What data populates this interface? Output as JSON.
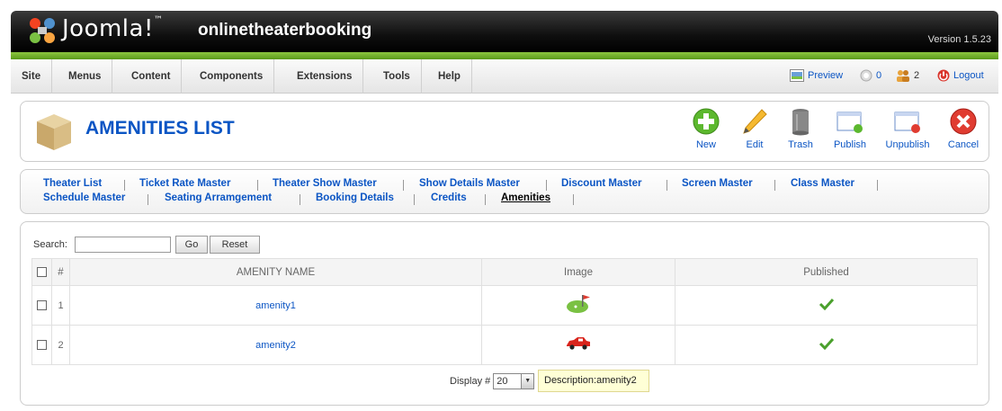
{
  "header": {
    "logo_text": "Joomla!",
    "site_name": "onlinetheaterbooking",
    "version": "Version 1.5.23"
  },
  "menu": {
    "items": [
      "Site",
      "Menus",
      "Content",
      "Components",
      "Extensions",
      "Tools",
      "Help"
    ],
    "preview": "Preview",
    "messages_count": "0",
    "users_count": "2",
    "logout": "Logout"
  },
  "toolbar": {
    "title": "AMENITIES LIST",
    "buttons": {
      "new": "New",
      "edit": "Edit",
      "trash": "Trash",
      "publish": "Publish",
      "unpublish": "Unpublish",
      "cancel": "Cancel"
    }
  },
  "submenu": {
    "row1": [
      "Theater List",
      "Ticket Rate Master",
      "Theater Show Master",
      "Show Details Master",
      "Discount Master",
      "Screen Master",
      "Class Master"
    ],
    "row2": [
      "Schedule Master",
      "Seating Arramgement",
      "Booking Details",
      "Credits",
      "Amenities"
    ],
    "active": "Amenities"
  },
  "filter": {
    "search_label": "Search:",
    "search_value": "",
    "go_label": "Go",
    "reset_label": "Reset"
  },
  "table": {
    "headers": [
      "#",
      "AMENITY NAME",
      "Image",
      "Published"
    ],
    "rows": [
      {
        "num": "1",
        "name": "amenity1",
        "image_icon": "golf-icon",
        "published": true
      },
      {
        "num": "2",
        "name": "amenity2",
        "image_icon": "car-icon",
        "published": true
      }
    ]
  },
  "pagination": {
    "display_label": "Display #",
    "display_value": "20",
    "tooltip": "Description:amenity2"
  },
  "colors": {
    "link": "#0b55c4",
    "header_bg": "#000000",
    "green_bar": "#8cc63f"
  }
}
